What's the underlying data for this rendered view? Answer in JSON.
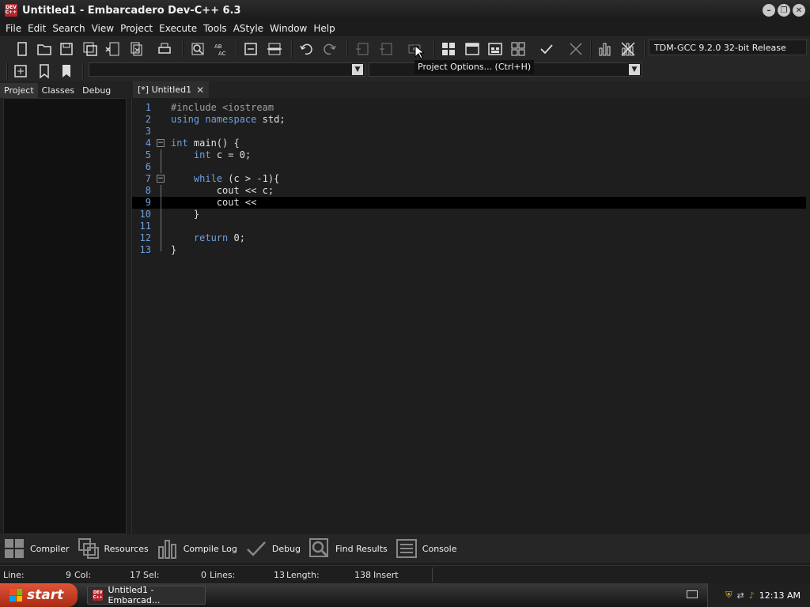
{
  "window": {
    "title": "Untitled1 - Embarcadero Dev-C++ 6.3",
    "app_icon_text": "DEV C++"
  },
  "menu": [
    "File",
    "Edit",
    "Search",
    "View",
    "Project",
    "Execute",
    "Tools",
    "AStyle",
    "Window",
    "Help"
  ],
  "toolbar": {
    "compiler": "TDM-GCC 9.2.0 32-bit Release",
    "tooltip": "Project Options... (Ctrl+H)"
  },
  "left_tabs": [
    "Project",
    "Classes",
    "Debug"
  ],
  "editor": {
    "tab_label": "[*] Untitled1",
    "current_line": 9,
    "lines": [
      {
        "n": "1",
        "text": "#include <iostream"
      },
      {
        "n": "2",
        "text": "using namespace std;"
      },
      {
        "n": "3",
        "text": ""
      },
      {
        "n": "4",
        "text": "int main() {"
      },
      {
        "n": "5",
        "text": "    int c = 0;"
      },
      {
        "n": "6",
        "text": ""
      },
      {
        "n": "7",
        "text": "    while (c > -1){"
      },
      {
        "n": "8",
        "text": "        cout << c;"
      },
      {
        "n": "9",
        "text": "        cout <<"
      },
      {
        "n": "10",
        "text": "    }"
      },
      {
        "n": "11",
        "text": ""
      },
      {
        "n": "12",
        "text": "    return 0;"
      },
      {
        "n": "13",
        "text": "}"
      }
    ]
  },
  "bottom_tabs": [
    {
      "label": "Compiler",
      "icon": "grid-icon"
    },
    {
      "label": "Resources",
      "icon": "resources-icon"
    },
    {
      "label": "Compile Log",
      "icon": "chart-icon"
    },
    {
      "label": "Debug",
      "icon": "check-icon"
    },
    {
      "label": "Find Results",
      "icon": "find-icon"
    },
    {
      "label": "Console",
      "icon": "console-icon"
    }
  ],
  "status": {
    "line_label": "Line:",
    "line_value": "9",
    "col_label": "Col:",
    "col_value": "17",
    "sel_label": "Sel:",
    "sel_value": "0",
    "lines_label": "Lines:",
    "lines_value": "13",
    "length_label": "Length:",
    "length_value": "138",
    "mode": "Insert"
  },
  "taskbar": {
    "start_label": "start",
    "task_label": "Untitled1 - Embarcad...",
    "clock": "12:13 AM"
  }
}
